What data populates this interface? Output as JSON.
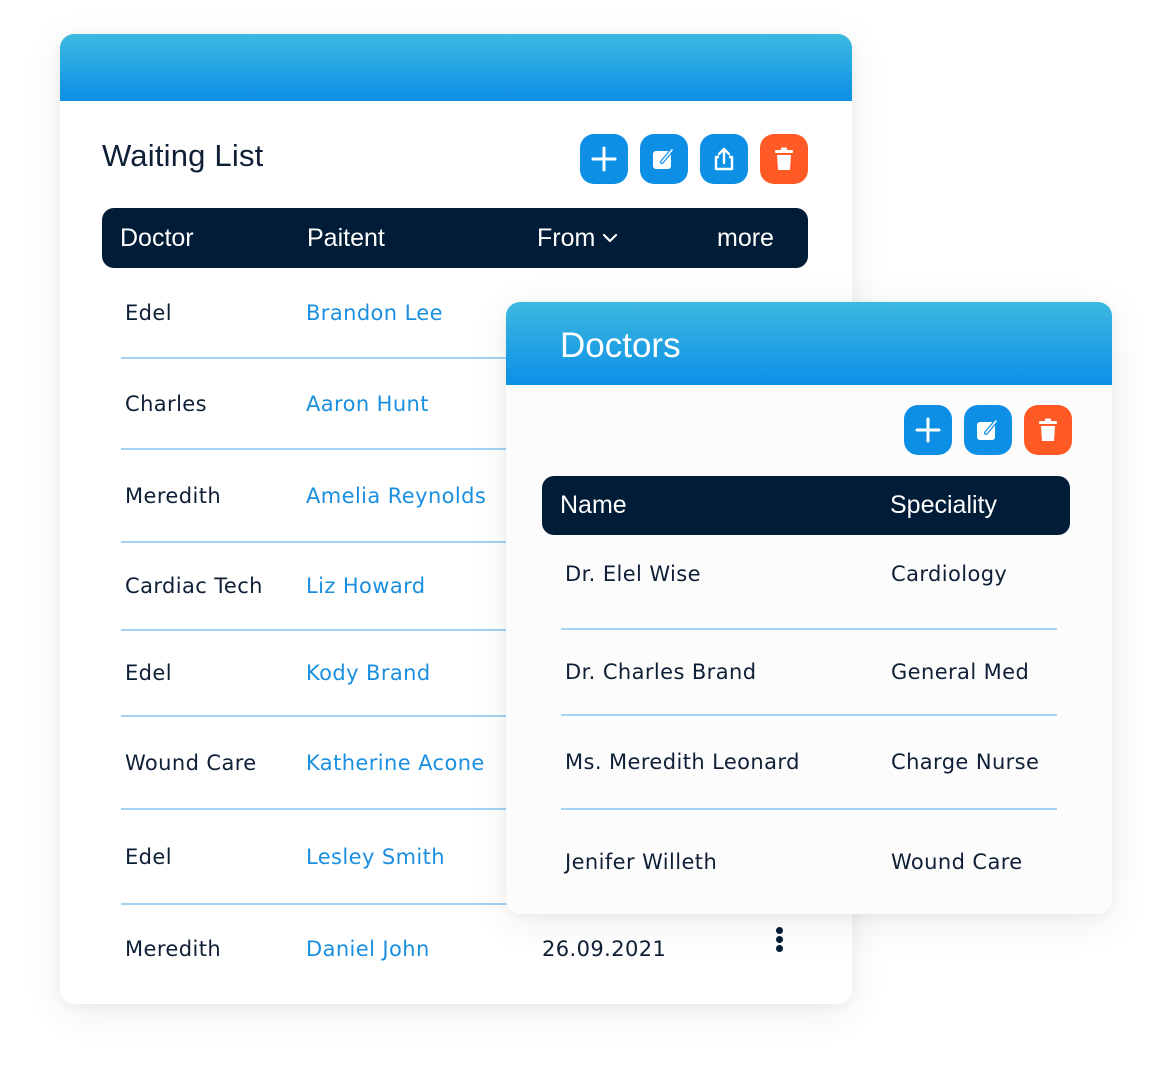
{
  "waiting_list": {
    "title": "Waiting List",
    "toolbar": {
      "add_icon": "plus-icon",
      "edit_icon": "edit-icon",
      "share_icon": "share-icon",
      "delete_icon": "trash-icon"
    },
    "columns": {
      "doctor": "Doctor",
      "patient": "Paitent",
      "from": "From",
      "more": "more"
    },
    "rows": [
      {
        "doctor": "Edel",
        "patient": "Brandon Lee",
        "date": ""
      },
      {
        "doctor": "Charles",
        "patient": "Aaron Hunt",
        "date": ""
      },
      {
        "doctor": "Meredith",
        "patient": "Amelia Reynolds",
        "date": ""
      },
      {
        "doctor": "Cardiac Tech",
        "patient": "Liz Howard",
        "date": ""
      },
      {
        "doctor": "Edel",
        "patient": "Kody Brand",
        "date": ""
      },
      {
        "doctor": "Wound Care",
        "patient": "Katherine Acone",
        "date": ""
      },
      {
        "doctor": "Edel",
        "patient": "Lesley Smith",
        "date": ""
      },
      {
        "doctor": "Meredith",
        "patient": "Daniel John",
        "date": "26.09.2021"
      }
    ]
  },
  "doctors": {
    "title": "Doctors",
    "columns": {
      "name": "Name",
      "speciality": "Speciality"
    },
    "rows": [
      {
        "name": "Dr. Elel Wise",
        "speciality": "Cardiology"
      },
      {
        "name": "Dr. Charles Brand",
        "speciality": "General Med"
      },
      {
        "name": "Ms. Meredith Leonard",
        "speciality": "Charge Nurse"
      },
      {
        "name": "Jenifer Willeth",
        "speciality": "Wound Care"
      }
    ]
  },
  "colors": {
    "primary": "#0d8fe6",
    "danger": "#ff5a26",
    "header_dark": "#011c36",
    "link": "#1a8fe0",
    "divider": "#a3d2f4"
  }
}
